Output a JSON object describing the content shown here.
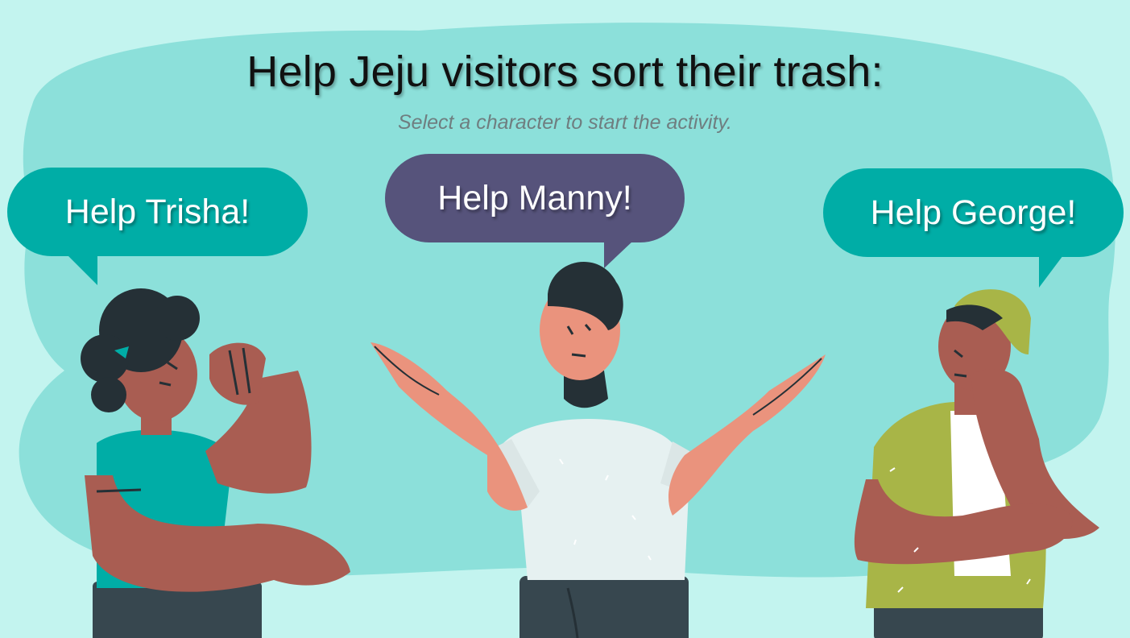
{
  "page": {
    "title": "Help Jeju visitors sort their trash:",
    "subtitle": "Select a character to start the activity."
  },
  "characters": [
    {
      "id": "trisha",
      "button_label": "Help Trisha!",
      "bubble_color": "#00ada6"
    },
    {
      "id": "manny",
      "button_label": "Help Manny!",
      "bubble_color": "#56537b"
    },
    {
      "id": "george",
      "button_label": "Help George!",
      "bubble_color": "#00ada6"
    }
  ],
  "colors": {
    "background": "#c3f4ef",
    "blob": "#8ce0da",
    "skin_dark": "#a95d52",
    "skin_light": "#ea937d",
    "hair": "#253036",
    "trisha_shirt": "#00ada6",
    "george_shirt": "#a8b547",
    "manny_shirt": "#e6f1f1",
    "pants": "#37474f"
  }
}
